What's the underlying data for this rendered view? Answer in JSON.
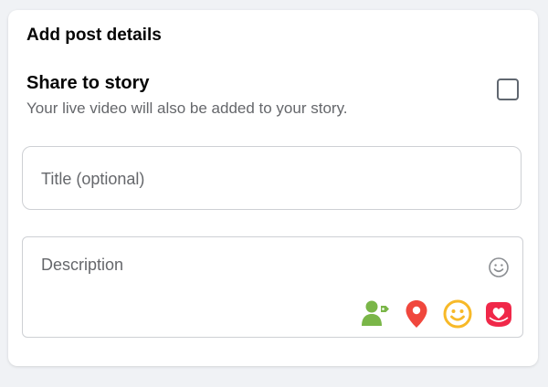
{
  "panel": {
    "title": "Add post details"
  },
  "share_story": {
    "title": "Share to story",
    "subtitle": "Your live video will also be added to your story.",
    "checked": false
  },
  "title_field": {
    "placeholder": "Title (optional)",
    "value": ""
  },
  "description_field": {
    "placeholder": "Description",
    "value": ""
  },
  "icons": {
    "emoji": "smiley-outline-icon",
    "tag_people": "tag-people-icon",
    "location": "location-pin-icon",
    "feeling": "feeling-smiley-icon",
    "sticker": "sticker-heart-icon"
  },
  "colors": {
    "tag_people": "#7ab648",
    "location": "#f0473d",
    "feeling": "#f7b928",
    "sticker": "#f02849"
  }
}
